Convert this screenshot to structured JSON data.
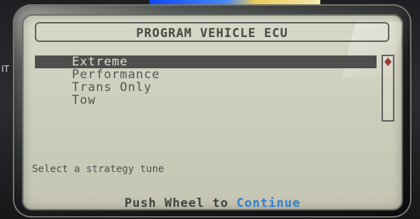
{
  "screen": {
    "title": "PROGRAM VEHICLE ECU",
    "menu": {
      "items": [
        {
          "label": "Extreme",
          "selected": true
        },
        {
          "label": "Performance",
          "selected": false
        },
        {
          "label": "Trans Only",
          "selected": false
        },
        {
          "label": "Tow",
          "selected": false
        }
      ]
    },
    "prompt": "Select a strategy tune",
    "footer": {
      "prefix": "Push Wheel to ",
      "accent": "Continue"
    }
  },
  "side_mark": {
    "text": "IT"
  },
  "colors": {
    "screen_bg": "#d0d0bf",
    "text": "#4f5552",
    "selection_bg": "#4c4f4b",
    "selection_text": "#dfe1d6",
    "accent": "#2e7fd0",
    "scroll_indicator": "#9b3c37"
  },
  "icons": {
    "scroll_indicator": "diamond-icon"
  }
}
